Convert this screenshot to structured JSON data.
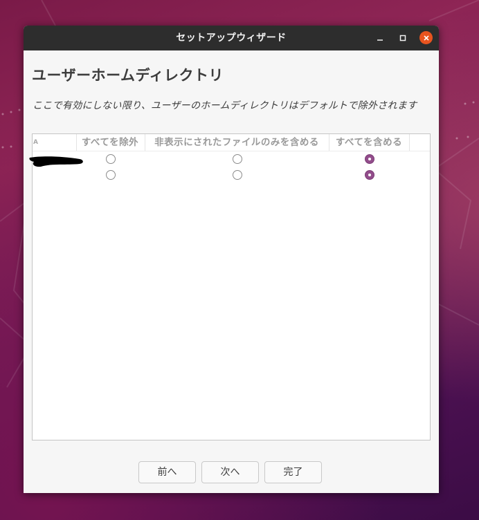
{
  "window": {
    "title": "セットアップウィザード"
  },
  "page": {
    "heading": "ユーザーホームディレクトリ",
    "description": "ここで有効にしない限り、ユーザーのホームディレクトリはデフォルトで除外されます"
  },
  "table": {
    "columns": {
      "name": "A",
      "exclude_all": "すべてを除外",
      "include_hidden_only": "非表示にされたファイルのみを含める",
      "include_all": "すべてを含める"
    },
    "rows": [
      {
        "selected": "include_all"
      },
      {
        "selected": "include_all"
      }
    ]
  },
  "buttons": {
    "prev": "前へ",
    "next": "次へ",
    "finish": "完了"
  },
  "colors": {
    "accent": "#924d8b",
    "close": "#e9541f",
    "titlebar": "#2d2d2d"
  }
}
